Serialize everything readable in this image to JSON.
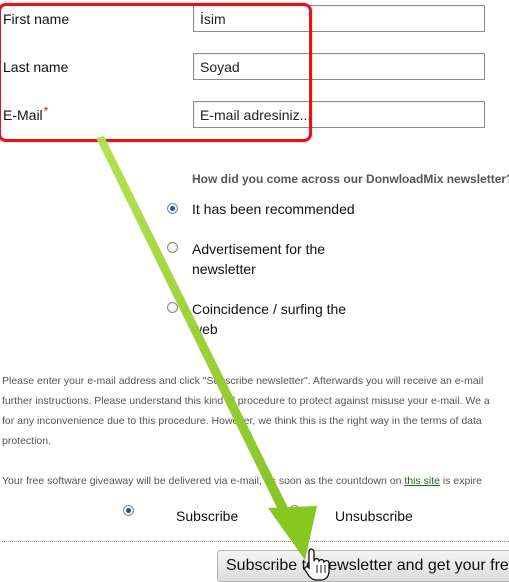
{
  "form": {
    "first_name_label": "First name",
    "first_name_value": "İsim",
    "last_name_label": "Last name",
    "last_name_value": "Soyad",
    "email_label": "E-Mail",
    "email_required_mark": "*",
    "email_value": "E-mail adresiniz..."
  },
  "survey": {
    "question": "How did you come across our DonwloadMix newsletter?",
    "options": [
      {
        "line1": "It has been recommended",
        "line2": "",
        "checked": true
      },
      {
        "line1": "Advertisement for the",
        "line2": "newsletter",
        "checked": false
      },
      {
        "line1": "Coincidence / surfing the",
        "line2": "web",
        "checked": false
      }
    ]
  },
  "info": {
    "lines": [
      "Please enter your e-mail address and click \"Subscribe newsletter\". Afterwards you will receive an e-mail",
      "further instructions. Please understand this kind of procedure to protect against misuse your e-mail. We a",
      "for any inconvenience due to this procedure. However, we think this is the right way in the terms of data",
      "protection."
    ],
    "giveaway_before": "Your free software giveaway will be delivered via e-mail, as soon as the countdown on ",
    "giveaway_link": "this site",
    "giveaway_after": " is expire"
  },
  "mode": {
    "subscribe_label": "Subscribe",
    "unsubscribe_label": "Unsubscribe",
    "selected": "subscribe"
  },
  "submit": {
    "label": "Subscribe to newsletter and get your free"
  },
  "annotation": {
    "highlight_color": "#e0141b",
    "arrow_color": "#8ccc1e"
  }
}
